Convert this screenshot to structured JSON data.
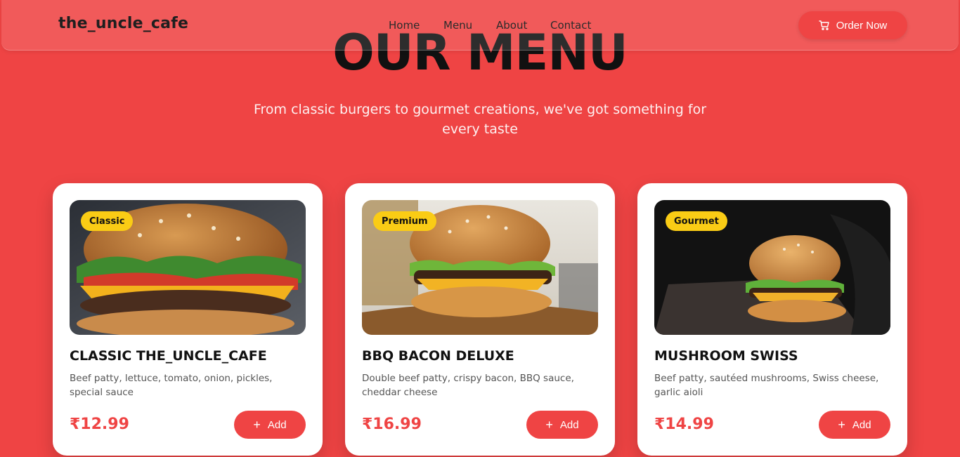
{
  "brand": "the_uncle_cafe",
  "nav": {
    "links": [
      "Home",
      "Menu",
      "About",
      "Contact"
    ],
    "order_label": "Order Now",
    "order_icon": "cart-icon"
  },
  "hero": {
    "title": "OUR MENU",
    "subtitle": "From classic burgers to gourmet creations, we've got something for every taste"
  },
  "colors": {
    "background": "#ef4444",
    "accent": "#ef4444",
    "badge": "#facc15"
  },
  "menu": [
    {
      "badge": "Classic",
      "name": "CLASSIC THE_UNCLE_CAFE",
      "description": "Beef patty, lettuce, tomato, onion, pickles, special sauce",
      "price": "₹12.99",
      "add_label": "Add"
    },
    {
      "badge": "Premium",
      "name": "BBQ BACON DELUXE",
      "description": "Double beef patty, crispy bacon, BBQ sauce, cheddar cheese",
      "price": "₹16.99",
      "add_label": "Add"
    },
    {
      "badge": "Gourmet",
      "name": "MUSHROOM SWISS",
      "description": "Beef patty, sautéed mushrooms, Swiss cheese, garlic aioli",
      "price": "₹14.99",
      "add_label": "Add"
    }
  ]
}
